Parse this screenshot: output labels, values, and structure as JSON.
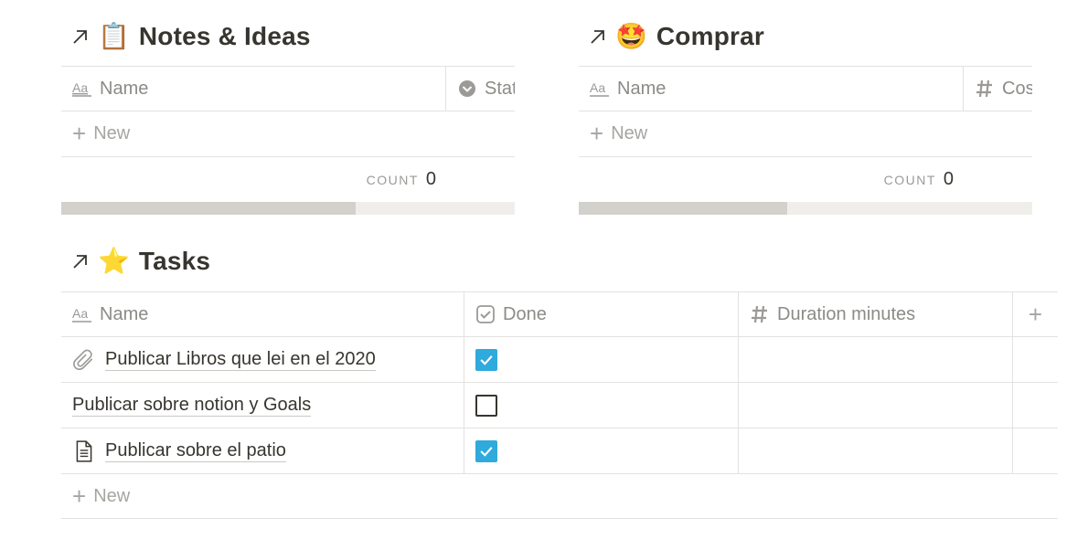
{
  "notes": {
    "title": "Notes & Ideas",
    "emoji": "📋",
    "columns": [
      "Name",
      "Stat"
    ],
    "new_label": "New",
    "count_label": "COUNT",
    "count_value": "0",
    "scroll_fraction": 0.65
  },
  "comprar": {
    "title": "Comprar",
    "emoji": "🤩",
    "columns": [
      "Name",
      "Cos"
    ],
    "new_label": "New",
    "count_label": "COUNT",
    "count_value": "0",
    "scroll_fraction": 0.46
  },
  "tasks": {
    "title": "Tasks",
    "emoji": "⭐",
    "columns": [
      "Name",
      "Done",
      "Duration minutes"
    ],
    "rows": [
      {
        "name": "Publicar Libros que lei en el 2020",
        "icon": "paperclip-icon",
        "done": true
      },
      {
        "name": "Publicar sobre notion y Goals",
        "icon": "",
        "done": false
      },
      {
        "name": "Publicar sobre el patio",
        "icon": "document-icon",
        "done": true
      }
    ],
    "new_label": "New"
  },
  "colors": {
    "accent_checkbox": "#2eaadc",
    "text": "#37352f",
    "muted": "#8c8b87",
    "border": "#e3e2e0"
  }
}
